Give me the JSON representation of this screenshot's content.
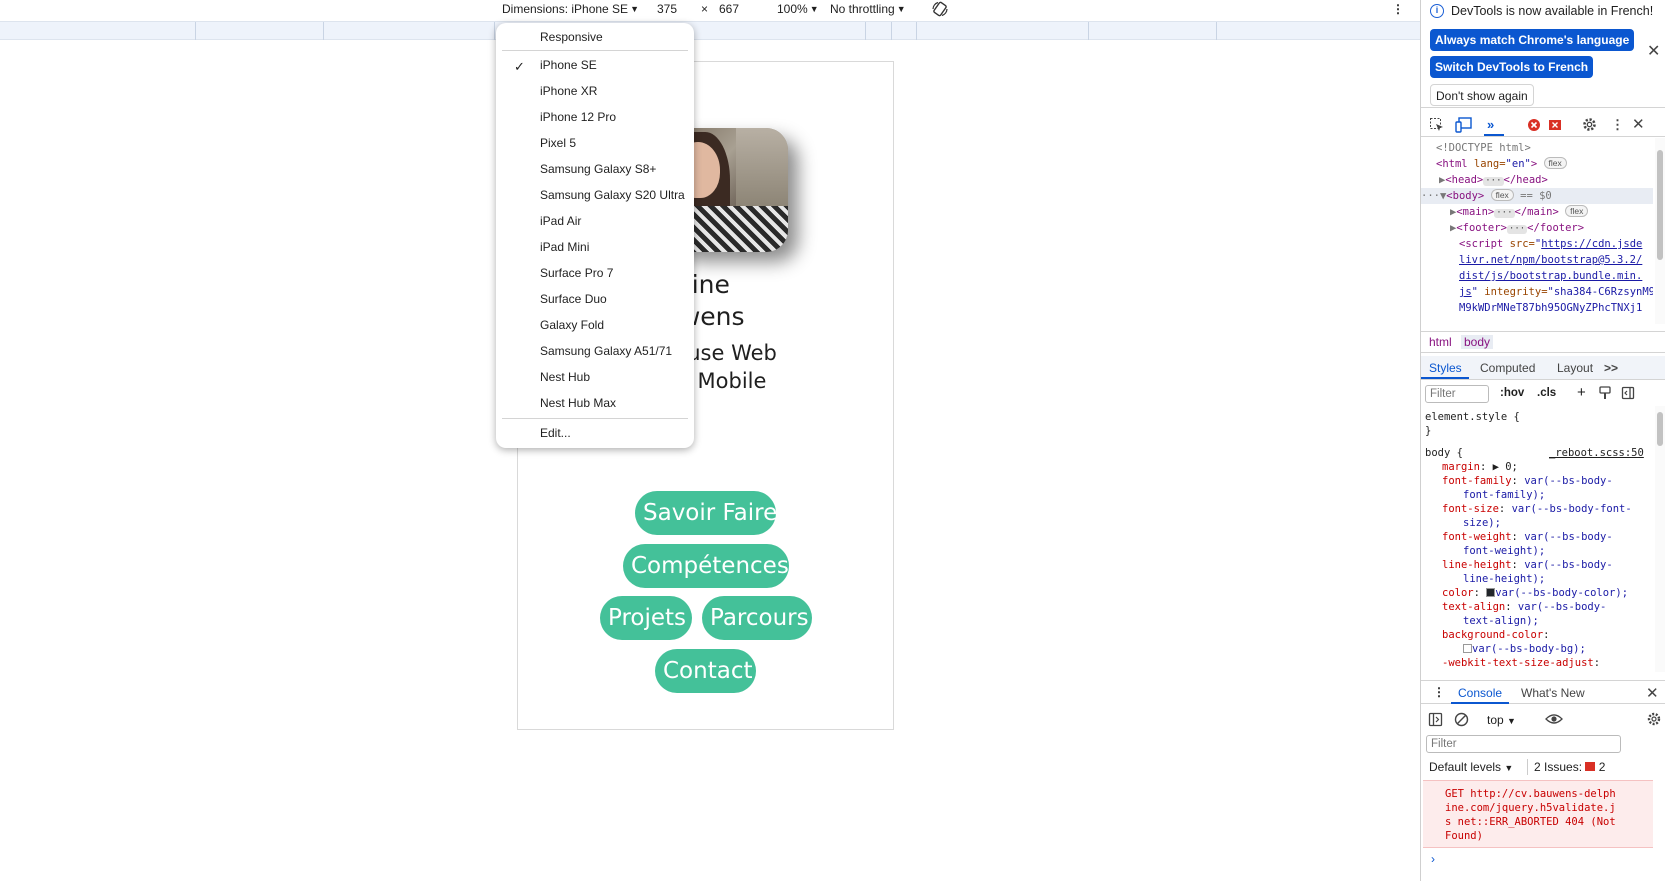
{
  "device_toolbar": {
    "dimensions_label": "Dimensions: iPhone SE",
    "width": "375",
    "times": "×",
    "height": "667",
    "zoom": "100%",
    "throttling": "No throttling",
    "rotate_icon": "rotate-icon",
    "more_icon": "⋮"
  },
  "device_menu": {
    "responsive": "Responsive",
    "checkmark": "✓",
    "items": [
      "iPhone SE",
      "iPhone XR",
      "iPhone 12 Pro",
      "Pixel 5",
      "Samsung Galaxy S8+",
      "Samsung Galaxy S20 Ultra",
      "iPad Air",
      "iPad Mini",
      "Surface Pro 7",
      "Surface Duo",
      "Galaxy Fold",
      "Samsung Galaxy A51/71",
      "Nest Hub",
      "Nest Hub Max"
    ],
    "selected": "iPhone SE",
    "edit": "Edit..."
  },
  "page": {
    "name_line1": "phine",
    "name_line2": "uwens",
    "title_line1": "peuse Web",
    "title_line2": "o Mobile",
    "buttons": [
      "Savoir Faire",
      "Compétences",
      "Projets",
      "Parcours",
      "Contact"
    ],
    "button_color": "#44c199"
  },
  "devtools": {
    "notice": {
      "text": "DevTools is now available in French!",
      "match_btn": "Always match Chrome's language",
      "switch_btn": "Switch DevTools to French",
      "dont_show": "Don't show again",
      "close": "✕"
    },
    "elements": {
      "doctype": "<!DOCTYPE html>",
      "html_open": "<html",
      "html_attr": " lang=",
      "html_val": "\"en\"",
      "html_close": ">",
      "flex": "flex",
      "head_open": "<head>",
      "head_close": "</head>",
      "body_open": "<body>",
      "body_eq": "== $0",
      "main_open": "<main>",
      "main_close": "</main>",
      "footer_open": "<footer>",
      "footer_close": "</footer>",
      "ellipsis": "···",
      "script_open": "<script",
      "script_src_attr": " src=",
      "script_src_q": "\"",
      "script_src_1": "https://cdn.jsde",
      "script_src_2": "livr.net/npm/bootstrap@5.3.2/",
      "script_src_3": "dist/js/bootstrap.bundle.min.",
      "script_src_4": "js",
      "script_integrity_attr": " integrity=",
      "script_integrity_val": "\"sha384-C6RzsynM9kWDrMNeT87bh95OGNyZPhcTNXj1",
      "script_line5": "M9kWDrMNeT87bh95OGNyZPhcTNXj1"
    },
    "breadcrumbs": [
      "html",
      "body"
    ],
    "styles_tabs": [
      "Styles",
      "Computed",
      "Layout",
      ">>"
    ],
    "styles_filter": "Filter",
    "hov": ":hov",
    "cls": ".cls",
    "rules": {
      "element_style": "element.style {",
      "close_brace": "}",
      "body_selector": "body {",
      "body_source": "_reboot.scss:50",
      "lines": [
        {
          "prop": "margin",
          "value": "▶ 0;"
        },
        {
          "prop": "font-family",
          "value": "var(--bs-body-"
        },
        {
          "prop": "",
          "value": "font-family);"
        },
        {
          "prop": "font-size",
          "value": "var(--bs-body-font-"
        },
        {
          "prop": "",
          "value": "size);"
        },
        {
          "prop": "font-weight",
          "value": "var(--bs-body-"
        },
        {
          "prop": "",
          "value": "font-weight);"
        },
        {
          "prop": "line-height",
          "value": "var(--bs-body-"
        },
        {
          "prop": "",
          "value": "line-height);"
        },
        {
          "prop": "color",
          "value": "var(--bs-body-color);"
        },
        {
          "prop": "text-align",
          "value": "var(--bs-body-"
        },
        {
          "prop": "",
          "value": "text-align);"
        },
        {
          "prop": "background-color",
          "value": ""
        },
        {
          "prop": "",
          "value": "var(--bs-body-bg);"
        },
        {
          "prop": "-webkit-text-size-adjust",
          "value": ""
        }
      ]
    },
    "console": {
      "tabs": [
        "Console",
        "What's New"
      ],
      "context": "top",
      "filter": "Filter",
      "levels": "Default levels",
      "issues_label": "2 Issues:",
      "issues_count": "2",
      "error_line1": "GET http://cv.bauwens-delph",
      "error_line2": "ine.com/jquery.h5validate.j",
      "error_line3": "s net::ERR_ABORTED 404 (Not",
      "error_line4": "Found)",
      "prompt": "›"
    }
  }
}
